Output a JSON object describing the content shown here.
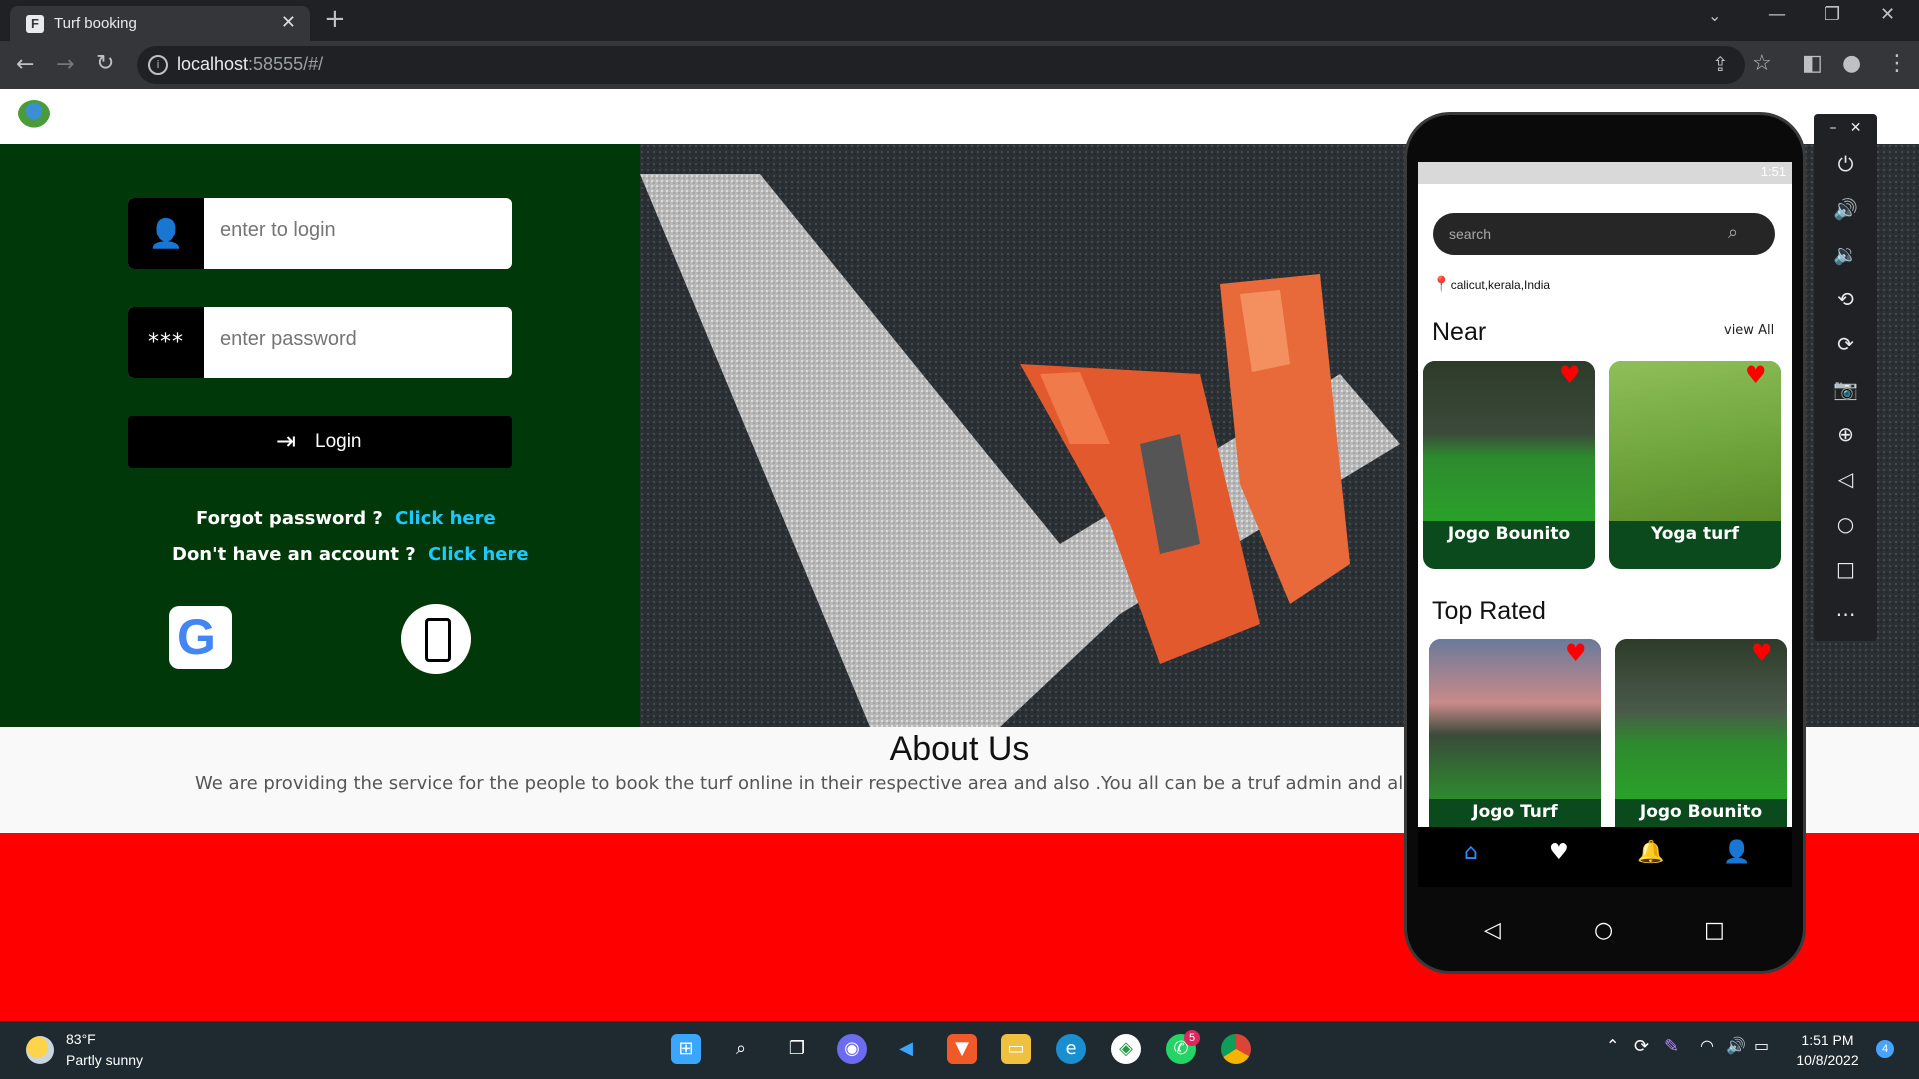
{
  "browser": {
    "tab_title": "Turf booking",
    "url_host": "localhost",
    "url_rest": ":58555/#/"
  },
  "login": {
    "username_placeholder": "enter to login",
    "password_placeholder": "enter password",
    "login_label": "Login",
    "forgot_text": "Forgot password ?",
    "forgot_link": "Click here",
    "account_text": "Don't have an account ?",
    "account_link": "Click here"
  },
  "about": {
    "title": "About Us",
    "text": "We are providing the service for the people to book the turf online in their respective area and also .You all can be a truf admin and also you ca"
  },
  "phone": {
    "status_time": "1:51",
    "search_placeholder": "search",
    "location": "calicut,kerala,India",
    "near_title": "Near",
    "view_all": "view All",
    "top_rated_title": "Top Rated",
    "near_cards": [
      {
        "name": "Jogo Bounito"
      },
      {
        "name": "Yoga turf"
      }
    ],
    "top_cards": [
      {
        "name": "Jogo Turf"
      },
      {
        "name": "Jogo Bounito"
      }
    ]
  },
  "taskbar": {
    "temp": "83°F",
    "weather": "Partly sunny",
    "time": "1:51 PM",
    "date": "10/8/2022",
    "whatsapp_badge": "5",
    "notif_badge": "4"
  },
  "colors": {
    "left_panel": "#003809",
    "link": "#1ec8ff",
    "red_band": "#ff0000",
    "card_green": "#0b4a1c"
  }
}
